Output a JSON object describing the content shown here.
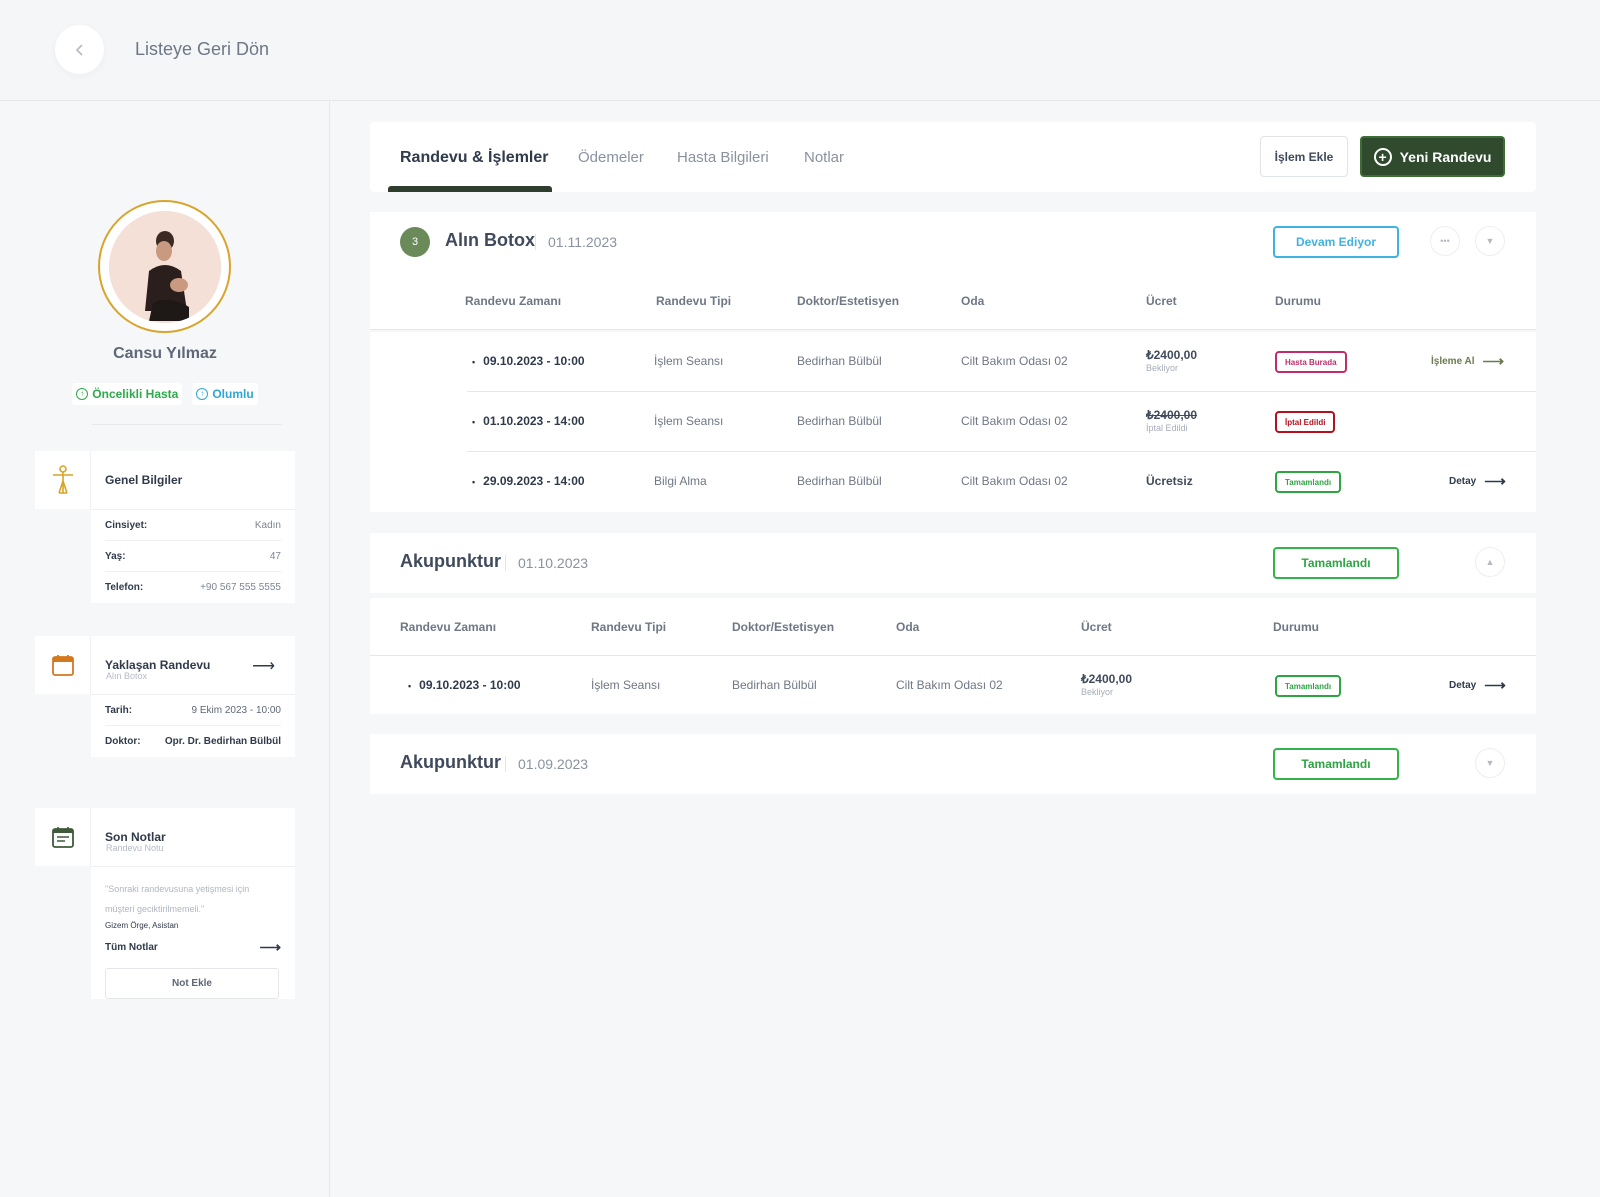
{
  "header": {
    "back_label": "Listeye Geri Dön"
  },
  "patient": {
    "name": "Cansu Yılmaz",
    "tags": [
      {
        "label": "Öncelikli Hasta",
        "color": "#2eaa4a"
      },
      {
        "label": "Olumlu",
        "color": "#2ea6d8"
      }
    ]
  },
  "general_info": {
    "title": "Genel Bilgiler",
    "rows": [
      {
        "key": "Cinsiyet:",
        "value": "Kadın"
      },
      {
        "key": "Yaş:",
        "value": "47"
      },
      {
        "key": "Telefon:",
        "value": "+90 567 555 5555"
      }
    ]
  },
  "upcoming": {
    "title": "Yaklaşan Randevu",
    "subtitle": "Alın Botox",
    "rows": [
      {
        "key": "Tarih:",
        "value": "9 Ekim 2023 - 10:00"
      },
      {
        "key": "Doktor:",
        "value": "Opr. Dr. Bedirhan Bülbül"
      }
    ]
  },
  "notes": {
    "title": "Son Notlar",
    "subtitle": "Randevu Notu",
    "text": "\"Sonraki randevusuna yetişmesi için müşteri geciktirilmemeli.\"",
    "author": "Gizem Örge, Asistan",
    "all_label": "Tüm Notlar",
    "add_label": "Not Ekle"
  },
  "tabs": {
    "items": [
      "Randevu & İşlemler",
      "Ödemeler",
      "Hasta Bilgileri",
      "Notlar"
    ],
    "active": 0,
    "add_action_label": "İşlem Ekle",
    "new_appointment_label": "Yeni Randevu"
  },
  "columns": {
    "time": "Randevu Zamanı",
    "type": "Randevu Tipi",
    "doctor": "Doktor/Estetisyen",
    "room": "Oda",
    "fee": "Ücret",
    "status": "Durumu"
  },
  "groups": [
    {
      "count": "3",
      "title": "Alın Botox",
      "date": "01.11.2023",
      "status": "Devam Ediyor",
      "expanded": true,
      "rows": [
        {
          "time": "09.10.2023 - 10:00",
          "type": "İşlem Seansı",
          "doctor": "Bedirhan Bülbül",
          "room": "Cilt Bakım Odası 02",
          "fee": "₺2400,00",
          "fee_note": "Bekliyor",
          "status": "Hasta Burada",
          "action": "İşleme Al"
        },
        {
          "time": "01.10.2023 - 14:00",
          "type": "İşlem Seansı",
          "doctor": "Bedirhan Bülbül",
          "room": "Cilt Bakım Odası 02",
          "fee": "₺2400,00",
          "fee_note": "İptal Edildi",
          "status": "İptal Edildi",
          "action": ""
        },
        {
          "time": "29.09.2023 - 14:00",
          "type": "Bilgi Alma",
          "doctor": "Bedirhan Bülbül",
          "room": "Cilt Bakım Odası 02",
          "fee": "Ücretsiz",
          "fee_note": "",
          "status": "Tamamlandı",
          "action": "Detay"
        }
      ]
    },
    {
      "title": "Akupunktur",
      "date": "01.10.2023",
      "status": "Tamamlandı",
      "expanded": true,
      "rows": [
        {
          "time": "09.10.2023 - 10:00",
          "type": "İşlem Seansı",
          "doctor": "Bedirhan Bülbül",
          "room": "Cilt Bakım Odası 02",
          "fee": "₺2400,00",
          "fee_note": "Bekliyor",
          "status": "Tamamlandı",
          "action": "Detay"
        }
      ]
    },
    {
      "title": "Akupunktur",
      "date": "01.09.2023",
      "status": "Tamamlandı",
      "expanded": false
    }
  ],
  "colors": {
    "primary": "#2f4a2d",
    "accent_gold": "#d9a429",
    "status_blue": "#3fb1e3",
    "status_green": "#2ea443",
    "status_pink": "#c12d6b",
    "status_red": "#b1121d"
  },
  "icons": [
    "chevron-left-icon",
    "person-icon",
    "calendar-icon",
    "notes-icon",
    "plus-circle-icon",
    "more-icon",
    "chevron-down-icon",
    "chevron-up-icon",
    "arrow-right-icon"
  ]
}
